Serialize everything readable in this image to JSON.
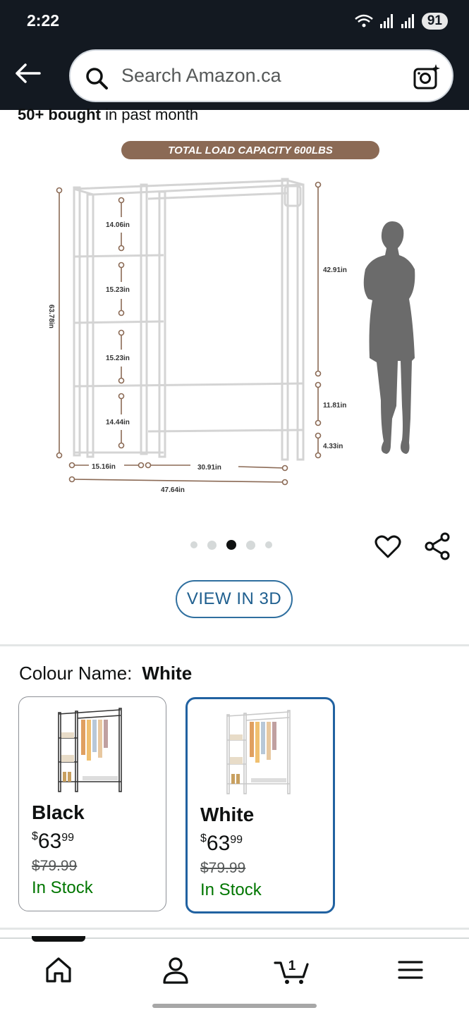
{
  "status_bar": {
    "time": "2:22",
    "battery": "91"
  },
  "search": {
    "placeholder": "Search Amazon.ca"
  },
  "product": {
    "bought_bold": "50+ bought",
    "bought_rest": " in past month",
    "image": {
      "banner": "TOTAL LOAD  CAPACITY 600LBS",
      "dimensions": [
        "14.06in",
        "15.23in",
        "15.23in",
        "14.44in",
        "63.78in",
        "42.91in",
        "11.81in",
        "4.33in",
        "15.16in",
        "30.91in",
        "47.64in"
      ]
    },
    "carousel": {
      "count": 5,
      "active_index": 2
    }
  },
  "view_3d_label": "VIEW IN 3D",
  "colour": {
    "label": "Colour Name:",
    "selected": "White",
    "options": [
      {
        "name": "Black",
        "currency": "$",
        "whole": "63",
        "cents": "99",
        "was": "$79.99",
        "stock": "In Stock"
      },
      {
        "name": "White",
        "currency": "$",
        "whole": "63",
        "cents": "99",
        "was": "$79.99",
        "stock": "In Stock"
      }
    ]
  },
  "nav": {
    "cart_count": "1"
  },
  "colors": {
    "header": "#131921",
    "accent": "#2162a1",
    "stock": "#007600",
    "banner": "#8b6a55"
  }
}
